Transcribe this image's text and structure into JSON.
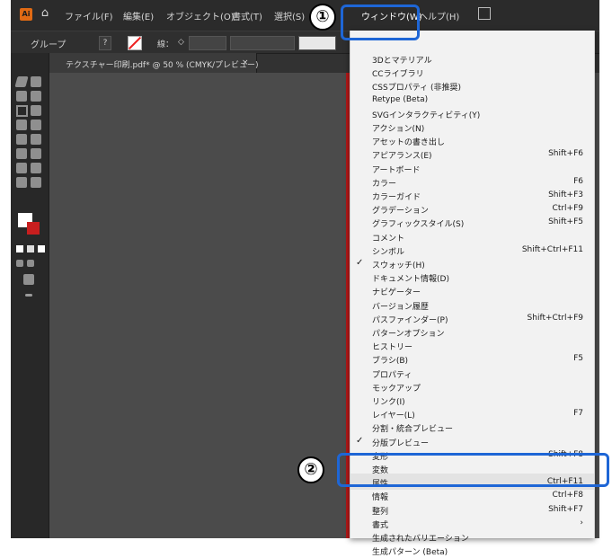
{
  "menubar": {
    "logo": "Ai",
    "home_icon": "home-icon",
    "items": [
      "ファイル(F)",
      "編集(E)",
      "オブジェクト(O)",
      "書式(T)",
      "選択(S)",
      "効",
      "ウィンドウ(W)",
      "ヘルプ(H)"
    ]
  },
  "control_bar": {
    "selection_label": "グループ",
    "stroke_label": "線：",
    "stroke_value": "◇"
  },
  "document_tab": {
    "title": "テクスチャー印刷.pdf* @ 50 % (CMYK/プレビュー)",
    "close": "×"
  },
  "window_menu": {
    "items": [
      {
        "label": "3Dとマテリアル",
        "shortcut": "",
        "checked": false
      },
      {
        "label": "CCライブラリ",
        "shortcut": "",
        "checked": false
      },
      {
        "label": "CSSプロパティ (非推奨)",
        "shortcut": "",
        "checked": false
      },
      {
        "label": "Retype (Beta)",
        "shortcut": "",
        "checked": false
      },
      {
        "label": "SVGインタラクティビティ(Y)",
        "shortcut": "",
        "checked": false
      },
      {
        "label": "アクション(N)",
        "shortcut": "",
        "checked": false
      },
      {
        "label": "アセットの書き出し",
        "shortcut": "",
        "checked": false
      },
      {
        "label": "アピアランス(E)",
        "shortcut": "Shift+F6",
        "checked": false
      },
      {
        "label": "アートボード",
        "shortcut": "",
        "checked": false
      },
      {
        "label": "カラー",
        "shortcut": "F6",
        "checked": false
      },
      {
        "label": "カラーガイド",
        "shortcut": "Shift+F3",
        "checked": false
      },
      {
        "label": "グラデーション",
        "shortcut": "Ctrl+F9",
        "checked": false
      },
      {
        "label": "グラフィックスタイル(S)",
        "shortcut": "Shift+F5",
        "checked": false
      },
      {
        "label": "コメント",
        "shortcut": "",
        "checked": false
      },
      {
        "label": "シンボル",
        "shortcut": "Shift+Ctrl+F11",
        "checked": false
      },
      {
        "label": "スウォッチ(H)",
        "shortcut": "",
        "checked": true
      },
      {
        "label": "ドキュメント情報(D)",
        "shortcut": "",
        "checked": false
      },
      {
        "label": "ナビゲーター",
        "shortcut": "",
        "checked": false
      },
      {
        "label": "バージョン履歴",
        "shortcut": "",
        "checked": false
      },
      {
        "label": "パスファインダー(P)",
        "shortcut": "Shift+Ctrl+F9",
        "checked": false
      },
      {
        "label": "パターンオプション",
        "shortcut": "",
        "checked": false
      },
      {
        "label": "ヒストリー",
        "shortcut": "",
        "checked": false
      },
      {
        "label": "ブラシ(B)",
        "shortcut": "F5",
        "checked": false
      },
      {
        "label": "プロパティ",
        "shortcut": "",
        "checked": false
      },
      {
        "label": "モックアップ",
        "shortcut": "",
        "checked": false
      },
      {
        "label": "リンク(I)",
        "shortcut": "",
        "checked": false
      },
      {
        "label": "レイヤー(L)",
        "shortcut": "F7",
        "checked": false
      },
      {
        "label": "分割・統合プレビュー",
        "shortcut": "",
        "checked": false
      },
      {
        "label": "分版プレビュー",
        "shortcut": "",
        "checked": true
      },
      {
        "label": "変形",
        "shortcut": "Shift+F8",
        "checked": false
      },
      {
        "label": "変数",
        "shortcut": "",
        "checked": false
      },
      {
        "label": "属性",
        "shortcut": "Ctrl+F11",
        "checked": false,
        "highlight": true
      },
      {
        "label": "情報",
        "shortcut": "Ctrl+F8",
        "checked": false
      },
      {
        "label": "整列",
        "shortcut": "Shift+F7",
        "checked": false
      },
      {
        "label": "書式",
        "shortcut": "›",
        "checked": false
      },
      {
        "label": "生成されたバリエーション",
        "shortcut": "",
        "checked": false
      },
      {
        "label": "生成パターン (Beta)",
        "shortcut": "",
        "checked": false
      }
    ]
  },
  "annotations": {
    "step1": "①",
    "step2": "②",
    "callout_color": "#1e66d6"
  }
}
